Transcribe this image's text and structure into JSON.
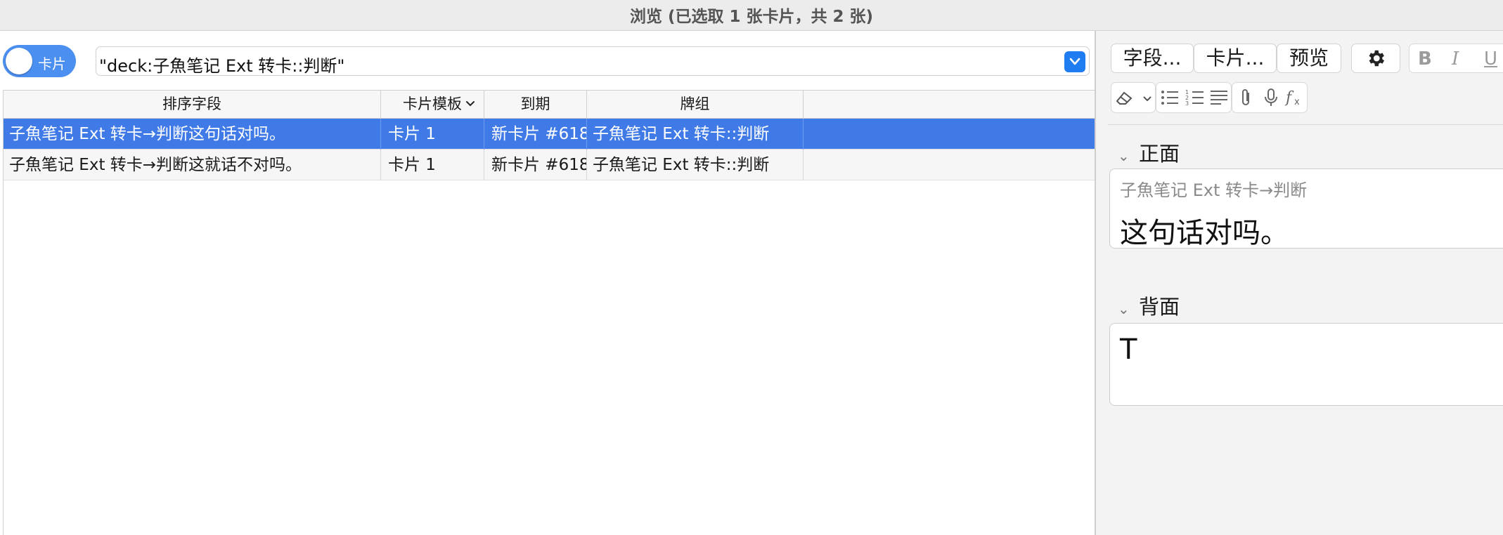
{
  "window": {
    "title": "浏览 (已选取 1 张卡片，共 2 张)"
  },
  "toolbar": {
    "toggle_label": "卡片",
    "search_value": "\"deck:子魚笔记 Ext 转卡::判断\""
  },
  "table": {
    "columns": [
      "排序字段",
      "卡片模板",
      "到期",
      "牌组"
    ],
    "rows": [
      {
        "sort_field": "子魚笔记 Ext 转卡→判断这句话对吗。",
        "template": "卡片 1",
        "due": "新卡片 #618...",
        "deck": "子魚笔记 Ext 转卡::判断",
        "selected": true
      },
      {
        "sort_field": "子魚笔记 Ext 转卡→判断这就话不对吗。",
        "template": "卡片 1",
        "due": "新卡片 #618...",
        "deck": "子魚笔记 Ext 转卡::判断",
        "selected": false
      }
    ]
  },
  "editor": {
    "buttons": {
      "fields": "字段...",
      "cards": "卡片...",
      "preview": "预览"
    },
    "format_letters": {
      "bold": "B",
      "italic": "I",
      "underline": "U"
    },
    "front": {
      "label": "正面",
      "small_text": "子魚笔记 Ext 转卡→判断",
      "big_text": "这句话对吗。"
    },
    "back": {
      "label": "背面",
      "big_text": "T"
    }
  },
  "colors": {
    "accent": "#3f7ae7",
    "toggle": "#4b8ff0",
    "dropdown": "#1f7cf1"
  }
}
